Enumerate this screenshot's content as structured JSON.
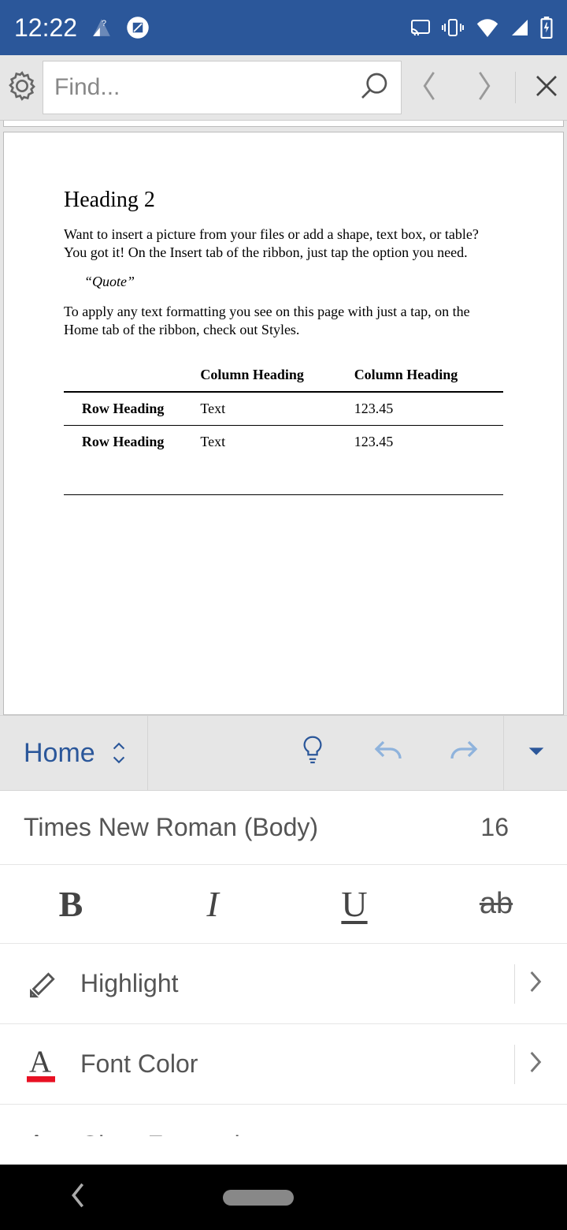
{
  "status": {
    "time": "12:22"
  },
  "findbar": {
    "placeholder": "Find..."
  },
  "document": {
    "heading": "Heading 2",
    "para1": "Want to insert a picture from your files or add a shape, text box, or table? You got it! On the Insert tab of the ribbon, just tap the option you need.",
    "quote": "“Quote”",
    "para2": "To apply any text formatting you see on this page with just a tap, on the Home tab of the ribbon, check out Styles.",
    "table": {
      "headers": [
        "",
        "Column Heading",
        "Column Heading"
      ],
      "rows": [
        [
          "Row Heading",
          "Text",
          "123.45"
        ],
        [
          "Row Heading",
          "Text",
          "123.45"
        ]
      ]
    }
  },
  "ribbon": {
    "tab": "Home"
  },
  "font": {
    "name": "Times New Roman (Body)",
    "size": "16"
  },
  "styles": {
    "bold": "B",
    "italic": "I",
    "underline": "U",
    "strike": "ab"
  },
  "options": {
    "highlight": "Highlight",
    "fontcolor": "Font Color",
    "clearformat": "Clear Formatting"
  }
}
